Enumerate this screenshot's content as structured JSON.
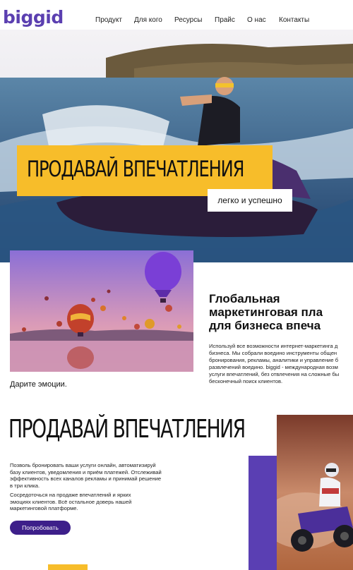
{
  "header": {
    "logo": "biggid",
    "nav": [
      "Продукт",
      "Для кого",
      "Ресурсы",
      "Прайс",
      "О нас",
      "Контакты"
    ]
  },
  "hero": {
    "title": "ПРОДАВАЙ ВПЕЧАТЛЕНИЯ",
    "subtitle": "легко и успешно"
  },
  "section2": {
    "heading_lines": [
      "Глобальная",
      "маркетинговая пла",
      "для бизнеса впеча"
    ],
    "body_lines": [
      "Используй все возможности интернет-маркетинга д",
      "бизнеса. Мы собрали воедино инструменты общен",
      "бронирования, рекламы, аналитики и управление б",
      "развлечений воедино. biggid - международная возм",
      "услуги впечатлений, без отвлечения на сложные бы",
      "бесконечный поиск клиентов."
    ],
    "caption": "Дарите эмоции."
  },
  "section3": {
    "title": "ПРОДАВАЙ ВПЕЧАТЛЕНИЯ",
    "para1_lines": [
      "Позволь бронировать ваши услуги онлайн, автоматизируй",
      "базу клиентов, уведомления и приём платежей. Отслеживай",
      "эффективность всех каналов рекламы и принимай решение",
      "в три клика."
    ],
    "para2_lines": [
      "Сосредоточься на продаже впечатлений и ярких",
      "эмоциях клиентов. Всё остальное доверь нашей",
      "маркетинговой платформе."
    ],
    "button": "Попробовать"
  },
  "colors": {
    "brand_purple": "#5b3fb0",
    "button_purple": "#3d1f8a",
    "accent_yellow": "#f7bd2a"
  }
}
